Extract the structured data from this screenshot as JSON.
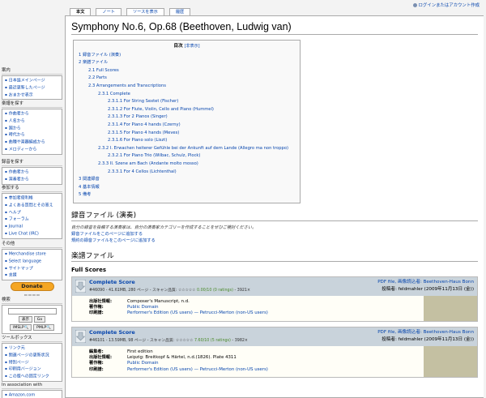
{
  "user_links": "ログインまたはアカウント作成",
  "tabs": [
    "本文",
    "ノート",
    "ソースを表示",
    "履歴"
  ],
  "page_title": "Symphony No.6, Op.68 (Beethoven, Ludwig van)",
  "toc": {
    "title": "目次",
    "toggle": "[非表示]",
    "items": [
      {
        "level": 1,
        "text": "1 録音ファイル (演奏)"
      },
      {
        "level": 1,
        "text": "2 楽譜ファイル"
      },
      {
        "level": 2,
        "text": "2.1 Full Scores"
      },
      {
        "level": 2,
        "text": "2.2 Parts"
      },
      {
        "level": 2,
        "text": "2.3 Arrangements and Transcriptions"
      },
      {
        "level": 3,
        "text": "2.3.1 Complete"
      },
      {
        "level": 4,
        "text": "2.3.1.1 For String Sextet (Fischer)"
      },
      {
        "level": 4,
        "text": "2.3.1.2 For Flute, Violin, Cello and Piano (Hummel)"
      },
      {
        "level": 4,
        "text": "2.3.1.3 For 2 Pianos (Singer)"
      },
      {
        "level": 4,
        "text": "2.3.1.4 For Piano 4 hands (Czerny)"
      },
      {
        "level": 4,
        "text": "2.3.1.5 For Piano 4 hands (Meves)"
      },
      {
        "level": 4,
        "text": "2.3.1.6 For Piano solo (Liszt)"
      },
      {
        "level": 3,
        "text": "2.3.2 I. Erwachen heiterer Gefühle bei der Ankunft auf dem Lande (Allegro ma non troppo)"
      },
      {
        "level": 4,
        "text": "2.3.2.1 For Piano Trio (Wilbac, Schulz, Plock)"
      },
      {
        "level": 3,
        "text": "2.3.3 II. Szene am Bach (Andante molto mosso)"
      },
      {
        "level": 4,
        "text": "2.3.3.1 For 4 Cellos (Lichtenthal)"
      },
      {
        "level": 1,
        "text": "3 関連録音"
      },
      {
        "level": 1,
        "text": "4 基本情報"
      },
      {
        "level": 1,
        "text": "5 備考"
      }
    ]
  },
  "recordings": {
    "heading": "録音ファイル (演奏)",
    "note_1": "自分の録音を投稿する演奏家は、自分の演奏家カテゴリーを作成することをぜひご検討ください。",
    "link_1": "録音ファイルをこのページに追加する",
    "link_2": "規約の録音ファイルをこのページに追加する"
  },
  "scores": {
    "heading": "楽譜ファイル",
    "subheading": "Full Scores",
    "entries": [
      {
        "title": "Complete Score",
        "meta_id": "#46090 - 41.61MB, 280 ページ - スキャン品質:",
        "meta_rating": "0.00/10 (0 ratings)",
        "meta_tail": "- 3921×",
        "file_line": "PDF file, 画像読込者: Beethoven-Haus Bonn",
        "upload_line": "投稿者: feldmahler (2009年11月13日 (金))",
        "rows": [
          {
            "k": "出版社情報:",
            "v": "Composer's Manuscript, n.d."
          },
          {
            "k": "著作権:",
            "v": "Public Domain"
          },
          {
            "k": "印刷譜:",
            "v": "Performer's Edition (US users) — Petrucci-Merton (non-US users)"
          }
        ]
      },
      {
        "title": "Complete Score",
        "meta_id": "#46101 - 13.59MB, 98 ページ - スキャン品質:",
        "meta_rating": "7.60/10 (5 ratings)",
        "meta_tail": "- 3982×",
        "file_line": "PDF file, 画像読込者: Beethoven-Haus Bonn",
        "upload_line": "投稿者: feldmahler (2009年11月13日 (金))",
        "rows": [
          {
            "k": "編集者:",
            "v": "First edition"
          },
          {
            "k": "出版社情報:",
            "v": "Leipzig: Breitkopf & Härtel, n.d.(1826). Plate 4311"
          },
          {
            "k": "著作権:",
            "v": "Public Domain"
          },
          {
            "k": "印刷譜:",
            "v": "Performer's Edition (US users) — Petrucci-Merton (non-US users)"
          }
        ]
      }
    ]
  },
  "sidebar": {
    "nav": {
      "title": "案内",
      "items": [
        "日本語メインページ",
        "最近更新したページ",
        "おまかせ表示"
      ]
    },
    "browse": {
      "title": "楽譜を探す",
      "items": [
        "作曲者から",
        "人名から",
        "国から",
        "時代から",
        "曲種や楽器編成から",
        "メロディーから"
      ]
    },
    "recordings": {
      "title": "録音を探す",
      "items": [
        "作曲者から",
        "演奏者から"
      ]
    },
    "participate": {
      "title": "参加する",
      "items": [
        "参加者便利帳",
        "よくある質問とその答え",
        "ヘルプ",
        "フォーラム",
        "Journal",
        "Live Chat (IRC)"
      ]
    },
    "other": {
      "title": "その他",
      "items": [
        "Merchandise store",
        "Select language",
        "サイトマップ",
        "支援"
      ]
    },
    "donate_label": "Donate",
    "search": {
      "title": "検索",
      "btn_go": "表示",
      "btn_search": "Go",
      "btn_a": "IMSLP🔍",
      "btn_b": "PMLP🔍"
    },
    "toolbox": {
      "title": "ツールボックス",
      "items": [
        "リンク元",
        "関連ページの更新状況",
        "特別ページ",
        "印刷用バージョン",
        "この版への固定リンク"
      ]
    },
    "assoc": {
      "title": "In association with",
      "items": [
        "Amazon.com"
      ]
    }
  }
}
